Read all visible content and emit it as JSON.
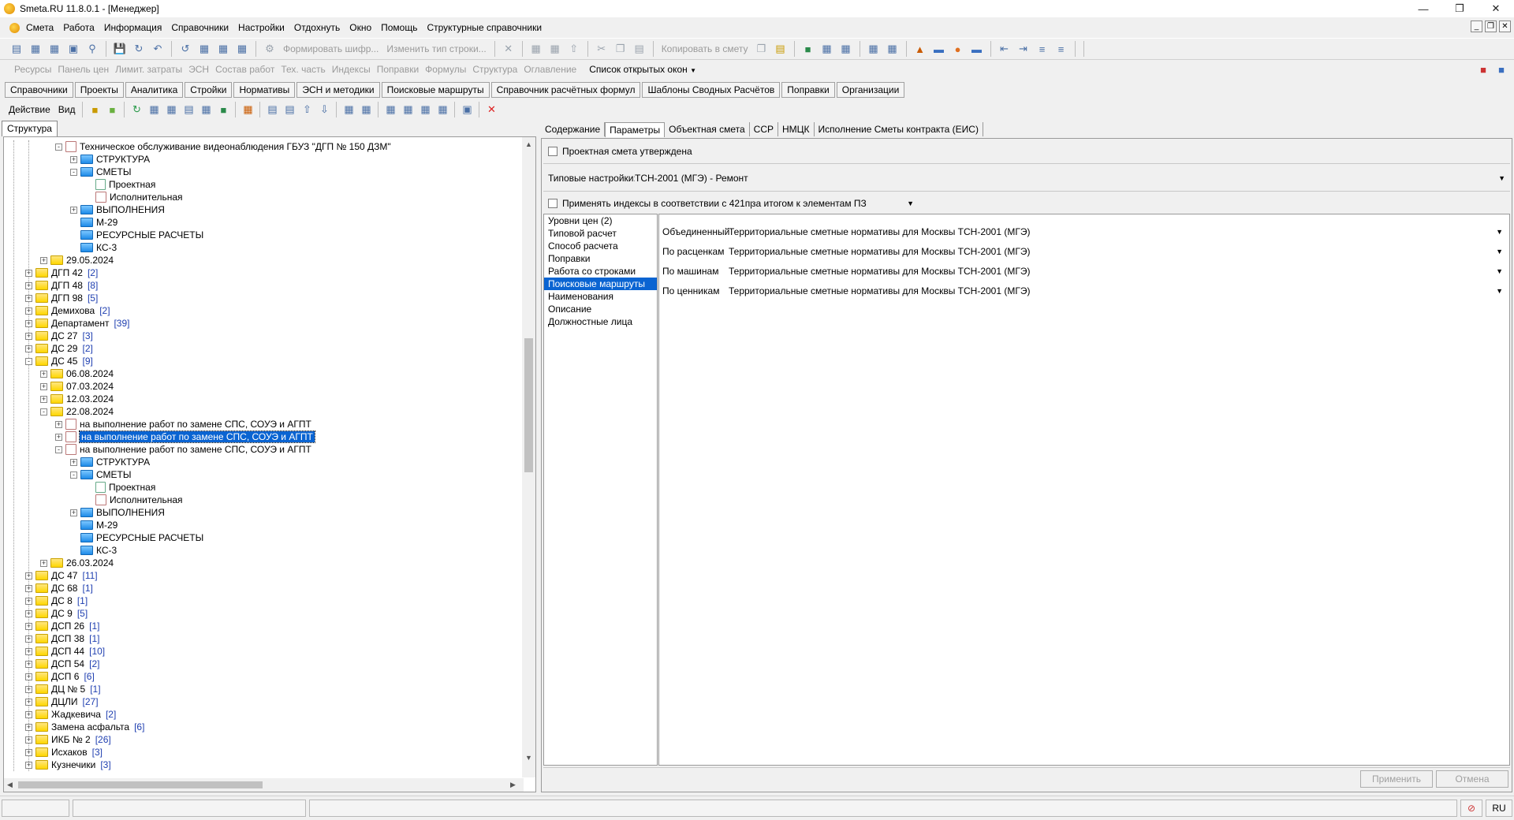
{
  "titlebar": {
    "title": "Smeta.RU  11.8.0.1  - [Менеджер]"
  },
  "menu": [
    "Смета",
    "Работа",
    "Информация",
    "Справочники",
    "Настройки",
    "Отдохнуть",
    "Окно",
    "Помощь",
    "Структурные справочники"
  ],
  "toolbar1": {
    "form_cipher": "Формировать шифр...",
    "change_type": "Изменить тип строки...",
    "copy_to_estimate": "Копировать в смету"
  },
  "toolbar2": {
    "items": [
      "Ресурсы",
      "Панель цен",
      "Лимит. затраты",
      "ЭСН",
      "Состав работ",
      "Тех. часть",
      "Индексы",
      "Поправки",
      "Формулы",
      "Структура",
      "Оглавление"
    ],
    "open_windows": "Список открытых окон"
  },
  "tabs_main": [
    "Справочники",
    "Проекты",
    "Аналитика",
    "Стройки",
    "Нормативы",
    "ЭСН и методики",
    "Поисковые маршруты",
    "Справочник расчётных формул",
    "Шаблоны Сводных Расчётов",
    "Поправки",
    "Организации"
  ],
  "action_bar": {
    "action": "Действие",
    "view": "Вид"
  },
  "left_tab": "Структура",
  "tree": [
    {
      "t": "Техническое обслуживание видеонаблюдения ГБУЗ \"ДГП № 150 ДЗМ\"",
      "lvl": 5,
      "pm": "-",
      "ic": "est",
      "c": ""
    },
    {
      "t": "СТРУКТУРА",
      "lvl": 6,
      "pm": "+",
      "ic": "blue",
      "c": ""
    },
    {
      "t": "СМЕТЫ",
      "lvl": 6,
      "pm": "-",
      "ic": "blue",
      "c": ""
    },
    {
      "t": "Проектная",
      "lvl": 7,
      "pm": "",
      "ic": "doc",
      "c": ""
    },
    {
      "t": "Исполнительная",
      "lvl": 7,
      "pm": "",
      "ic": "est",
      "c": ""
    },
    {
      "t": "ВЫПОЛНЕНИЯ",
      "lvl": 6,
      "pm": "+",
      "ic": "blue",
      "c": ""
    },
    {
      "t": "М-29",
      "lvl": 6,
      "pm": "",
      "ic": "blue",
      "c": ""
    },
    {
      "t": "РЕСУРСНЫЕ РАСЧЕТЫ",
      "lvl": 6,
      "pm": "",
      "ic": "blue",
      "c": ""
    },
    {
      "t": "КС-3",
      "lvl": 6,
      "pm": "",
      "ic": "blue",
      "c": ""
    },
    {
      "t": "29.05.2024",
      "lvl": 4,
      "pm": "+",
      "ic": "fold",
      "c": ""
    },
    {
      "t": "ДГП 42",
      "lvl": 3,
      "pm": "+",
      "ic": "fold",
      "c": "[2]"
    },
    {
      "t": "ДГП 48",
      "lvl": 3,
      "pm": "+",
      "ic": "fold",
      "c": "[8]"
    },
    {
      "t": "ДГП 98",
      "lvl": 3,
      "pm": "+",
      "ic": "fold",
      "c": "[5]"
    },
    {
      "t": "Демихова",
      "lvl": 3,
      "pm": "+",
      "ic": "fold",
      "c": "[2]"
    },
    {
      "t": "Департамент",
      "lvl": 3,
      "pm": "+",
      "ic": "fold",
      "c": "[39]"
    },
    {
      "t": "ДС 27",
      "lvl": 3,
      "pm": "+",
      "ic": "fold",
      "c": "[3]"
    },
    {
      "t": "ДС 29",
      "lvl": 3,
      "pm": "+",
      "ic": "fold",
      "c": "[2]"
    },
    {
      "t": "ДС 45",
      "lvl": 3,
      "pm": "-",
      "ic": "fold",
      "c": "[9]"
    },
    {
      "t": "06.08.2024",
      "lvl": 4,
      "pm": "+",
      "ic": "fold",
      "c": ""
    },
    {
      "t": "07.03.2024",
      "lvl": 4,
      "pm": "+",
      "ic": "fold",
      "c": ""
    },
    {
      "t": "12.03.2024",
      "lvl": 4,
      "pm": "+",
      "ic": "fold",
      "c": ""
    },
    {
      "t": "22.08.2024",
      "lvl": 4,
      "pm": "-",
      "ic": "fold",
      "c": ""
    },
    {
      "t": "на выполнение работ по замене СПС, СОУЭ и АГПТ",
      "lvl": 5,
      "pm": "+",
      "ic": "est",
      "c": ""
    },
    {
      "t": "на выполнение работ по замене СПС, СОУЭ и АГПТ",
      "lvl": 5,
      "pm": "+",
      "ic": "est",
      "c": "",
      "sel": true
    },
    {
      "t": "на выполнение работ по замене СПС, СОУЭ и АГПТ",
      "lvl": 5,
      "pm": "-",
      "ic": "est",
      "c": ""
    },
    {
      "t": "СТРУКТУРА",
      "lvl": 6,
      "pm": "+",
      "ic": "blue",
      "c": ""
    },
    {
      "t": "СМЕТЫ",
      "lvl": 6,
      "pm": "-",
      "ic": "blue",
      "c": ""
    },
    {
      "t": "Проектная",
      "lvl": 7,
      "pm": "",
      "ic": "doc",
      "c": ""
    },
    {
      "t": "Исполнительная",
      "lvl": 7,
      "pm": "",
      "ic": "est",
      "c": ""
    },
    {
      "t": "ВЫПОЛНЕНИЯ",
      "lvl": 6,
      "pm": "+",
      "ic": "blue",
      "c": ""
    },
    {
      "t": "М-29",
      "lvl": 6,
      "pm": "",
      "ic": "blue",
      "c": ""
    },
    {
      "t": "РЕСУРСНЫЕ РАСЧЕТЫ",
      "lvl": 6,
      "pm": "",
      "ic": "blue",
      "c": ""
    },
    {
      "t": "КС-3",
      "lvl": 6,
      "pm": "",
      "ic": "blue",
      "c": ""
    },
    {
      "t": "26.03.2024",
      "lvl": 4,
      "pm": "+",
      "ic": "fold",
      "c": ""
    },
    {
      "t": "ДС 47",
      "lvl": 3,
      "pm": "+",
      "ic": "fold",
      "c": "[11]"
    },
    {
      "t": "ДС 68",
      "lvl": 3,
      "pm": "+",
      "ic": "fold",
      "c": "[1]"
    },
    {
      "t": "ДС 8",
      "lvl": 3,
      "pm": "+",
      "ic": "fold",
      "c": "[1]"
    },
    {
      "t": "ДС 9",
      "lvl": 3,
      "pm": "+",
      "ic": "fold",
      "c": "[5]"
    },
    {
      "t": "ДСП 26",
      "lvl": 3,
      "pm": "+",
      "ic": "fold",
      "c": "[1]"
    },
    {
      "t": "ДСП 38",
      "lvl": 3,
      "pm": "+",
      "ic": "fold",
      "c": "[1]"
    },
    {
      "t": "ДСП 44",
      "lvl": 3,
      "pm": "+",
      "ic": "fold",
      "c": "[10]"
    },
    {
      "t": "ДСП 54",
      "lvl": 3,
      "pm": "+",
      "ic": "fold",
      "c": "[2]"
    },
    {
      "t": "ДСП 6",
      "lvl": 3,
      "pm": "+",
      "ic": "fold",
      "c": "[6]"
    },
    {
      "t": "ДЦ № 5",
      "lvl": 3,
      "pm": "+",
      "ic": "fold",
      "c": "[1]"
    },
    {
      "t": "ДЦЛИ",
      "lvl": 3,
      "pm": "+",
      "ic": "fold",
      "c": "[27]"
    },
    {
      "t": "Жадкевича",
      "lvl": 3,
      "pm": "+",
      "ic": "fold",
      "c": "[2]"
    },
    {
      "t": "Замена асфальта",
      "lvl": 3,
      "pm": "+",
      "ic": "fold",
      "c": "[6]"
    },
    {
      "t": "ИКБ № 2",
      "lvl": 3,
      "pm": "+",
      "ic": "fold",
      "c": "[26]"
    },
    {
      "t": "Исхаков",
      "lvl": 3,
      "pm": "+",
      "ic": "fold",
      "c": "[3]"
    },
    {
      "t": "Кузнечики",
      "lvl": 3,
      "pm": "+",
      "ic": "fold",
      "c": "[3]"
    }
  ],
  "right_tabs": [
    "Содержание",
    "Параметры",
    "Объектная смета",
    "ССР",
    "НМЦК",
    "Исполнение Сметы контракта (ЕИС)"
  ],
  "params": {
    "approved_label": "Проектная смета утверждена",
    "typical_label": "Типовые настройки:",
    "typical_value": "ТСН-2001 (МГЭ) - Ремонт",
    "indices_label": "Применять индексы в соответствии с 421пр",
    "indices_value": "за итогом к элементам ПЗ"
  },
  "nav": [
    "Уровни цен (2)",
    "Типовой расчет",
    "Способ расчета",
    "Поправки",
    "Работа со строками",
    "Поисковые маршруты",
    "Наименования",
    "Описание",
    "Должностные лица"
  ],
  "nav_active": "Поисковые маршруты",
  "routes": [
    {
      "label": "Объединенный",
      "value": "Территориальные сметные нормативы для Москвы ТСН-2001 (МГЭ)"
    },
    {
      "label": "По расценкам",
      "value": "Территориальные сметные нормативы для Москвы ТСН-2001 (МГЭ)"
    },
    {
      "label": "По машинам",
      "value": "Территориальные сметные нормативы для Москвы ТСН-2001 (МГЭ)"
    },
    {
      "label": "По ценникам",
      "value": "Территориальные сметные нормативы для Москвы ТСН-2001 (МГЭ)"
    }
  ],
  "buttons": {
    "apply": "Применить",
    "cancel": "Отмена"
  },
  "status": {
    "lang": "RU"
  },
  "colors": {
    "selection": "#0a64d2",
    "count": "#1f3fb0"
  }
}
